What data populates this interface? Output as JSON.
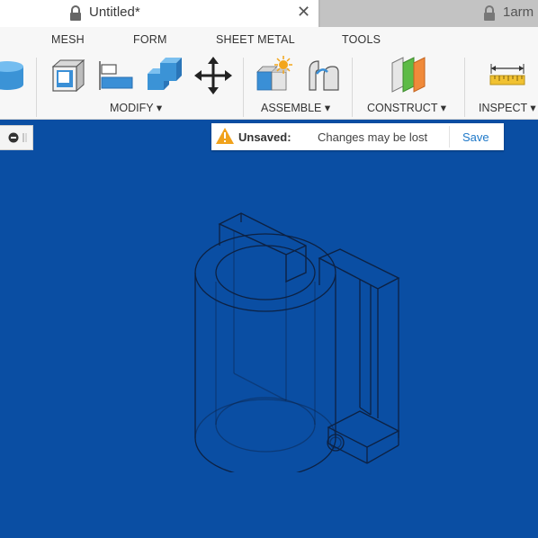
{
  "tabs": [
    {
      "title": "Untitled*",
      "active": true
    },
    {
      "title": "1arm",
      "active": false
    }
  ],
  "menu": [
    "MESH",
    "FORM",
    "SHEET METAL",
    "TOOLS"
  ],
  "groups": [
    "MODIFY",
    "ASSEMBLE",
    "CONSTRUCT",
    "INSPECT"
  ],
  "notice": {
    "label": "Unsaved:",
    "message": "Changes may be lost",
    "action": "Save"
  },
  "colors": {
    "canvas": "#0a4ea3",
    "warning": "#f0a21c",
    "link": "#1e78c8"
  }
}
